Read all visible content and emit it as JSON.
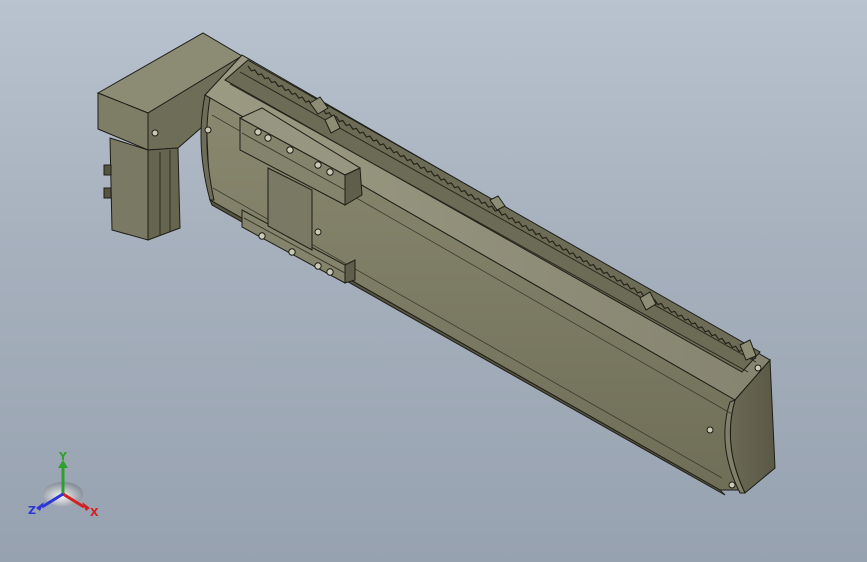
{
  "viewport": {
    "model": "linear-actuator-module",
    "colors": {
      "background_top": "#b9c3cf",
      "background_bottom": "#97a2b0",
      "body_face": "#7c7b63",
      "body_light": "#8f8e76",
      "body_dark": "#55543f",
      "edge": "#1e1e18",
      "rail": "#3c3b2e"
    }
  },
  "triad": {
    "x_label": "X",
    "y_label": "Y",
    "z_label": "Z",
    "x_color": "#d42020",
    "y_color": "#2ea02e",
    "z_color": "#2c36d6"
  }
}
